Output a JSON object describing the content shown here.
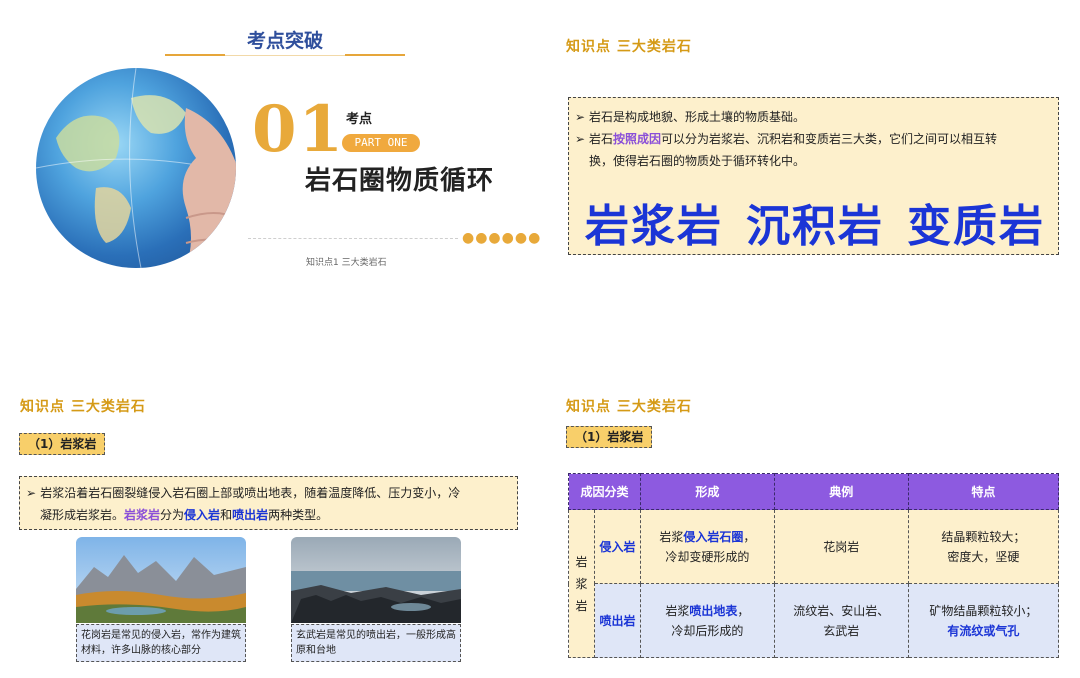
{
  "slide1": {
    "title": "考点突破",
    "number": "01",
    "kaodian": "考点",
    "part_label": "PART ONE",
    "heading": "岩石圈物质循环",
    "dots": "●●●●●●",
    "subnote": "知识点1  三大类岩石"
  },
  "slide2": {
    "section_title": "知识点  三大类岩石",
    "line1": "岩石是构成地貌、形成土壤的物质基础。",
    "line2_a": "岩石",
    "line2_hl": "按照成因",
    "line2_b": "可以分为岩浆岩、沉积岩和变质岩三大类，它们之间可以相互转",
    "line3": "换，使得岩石圈的物质处于循环转化中。",
    "big": [
      "岩浆岩",
      "沉积岩",
      "变质岩"
    ]
  },
  "slide3": {
    "section_title": "知识点  三大类岩石",
    "tag": "（1）岩浆岩",
    "text_a": "岩浆沿着岩石圈裂缝侵入岩石圈上部或喷出地表，随着温度降低、压力变小，冷",
    "text_b": "凝形成岩浆岩。",
    "text_hl1": "岩浆岩",
    "text_c": "分为",
    "text_hl2": "侵入岩",
    "text_d": "和",
    "text_hl3": "喷出岩",
    "text_e": "两种类型。",
    "caption1": "花岗岩是常见的侵入岩，常作为建筑材料，许多山脉的核心部分",
    "caption2": "玄武岩是常见的喷出岩，一般形成高原和台地"
  },
  "slide4": {
    "section_title": "知识点  三大类岩石",
    "tag": "（1）岩浆岩",
    "headers": [
      "成因分类",
      "形成",
      "典例",
      "特点"
    ],
    "group": "岩浆岩",
    "group_chars": [
      "岩",
      "浆",
      "岩"
    ],
    "rows": [
      {
        "type": "侵入岩",
        "form_a": "岩浆",
        "form_hl": "侵入岩石圈",
        "form_b": "，",
        "form_c": "冷却变硬形成的",
        "example": "花岗岩",
        "feat_a": "结晶颗粒较大；",
        "feat_b": "密度大，坚硬"
      },
      {
        "type": "喷出岩",
        "form_a": "岩浆",
        "form_hl": "喷出地表",
        "form_b": "，",
        "form_c": "冷却后形成的",
        "example_a": "流纹岩、安山岩、",
        "example_b": "玄武岩",
        "feat_a": "矿物结晶颗粒较小；",
        "feat_hl": "有流纹或气孔"
      }
    ]
  }
}
